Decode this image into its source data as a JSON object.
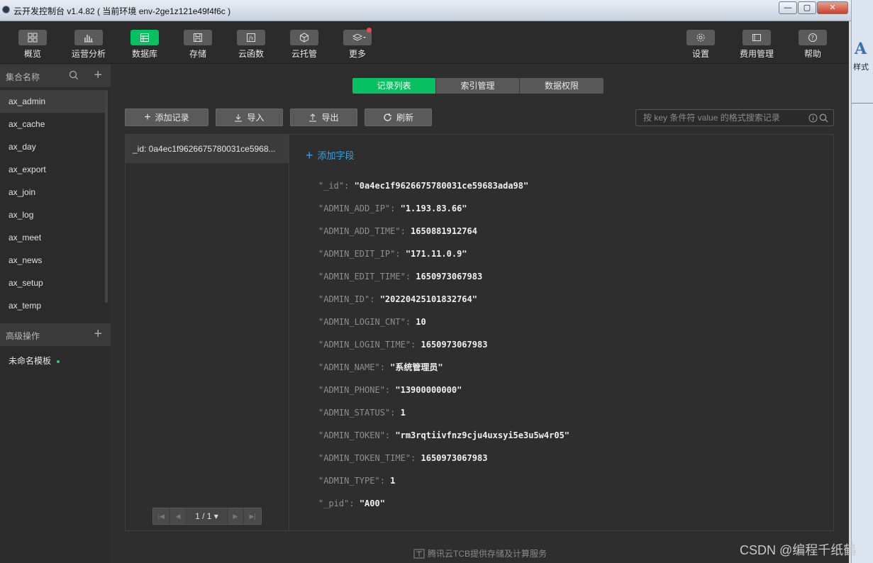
{
  "window": {
    "title": "云开发控制台 v1.4.82 ( 当前环境 env-2ge1z121e49f4f6c )",
    "buttons": [
      "—",
      "▢",
      "✕"
    ]
  },
  "toolbar": {
    "left": [
      {
        "label": "概览",
        "icon": "grid-icon"
      },
      {
        "label": "运营分析",
        "icon": "bar-chart-icon"
      },
      {
        "label": "数据库",
        "icon": "database-icon",
        "active": true
      },
      {
        "label": "存储",
        "icon": "save-icon"
      },
      {
        "label": "云函数",
        "icon": "function-icon"
      },
      {
        "label": "云托管",
        "icon": "cube-icon"
      },
      {
        "label": "更多",
        "icon": "layers-icon",
        "badge": true
      }
    ],
    "right": [
      {
        "label": "设置",
        "icon": "gear-icon"
      },
      {
        "label": "费用管理",
        "icon": "billing-icon"
      },
      {
        "label": "帮助",
        "icon": "help-icon"
      }
    ]
  },
  "sidebar": {
    "collections_title": "集合名称",
    "collections": [
      "ax_admin",
      "ax_cache",
      "ax_day",
      "ax_export",
      "ax_join",
      "ax_log",
      "ax_meet",
      "ax_news",
      "ax_setup",
      "ax_temp"
    ],
    "active_collection": "ax_admin",
    "advanced_title": "高级操作",
    "template_label": "未命名模板"
  },
  "tabs": [
    "记录列表",
    "索引管理",
    "数据权限"
  ],
  "actions": {
    "add_record": "添加记录",
    "import": "导入",
    "export": "导出",
    "refresh": "刷新"
  },
  "search": {
    "placeholder": "按 key 条件符 value 的格式搜索记录"
  },
  "records": [
    {
      "label": "_id: 0a4ec1f9626675780031ce5968..."
    }
  ],
  "pager": {
    "text": "1 / 1 ▾"
  },
  "detail": {
    "add_field": "添加字段",
    "fields": [
      {
        "key": "\"_id\"",
        "value": "\"0a4ec1f9626675780031ce59683ada98\""
      },
      {
        "key": "\"ADMIN_ADD_IP\"",
        "value": "\"1.193.83.66\""
      },
      {
        "key": "\"ADMIN_ADD_TIME\"",
        "value": "1650881912764"
      },
      {
        "key": "\"ADMIN_EDIT_IP\"",
        "value": "\"171.11.0.9\""
      },
      {
        "key": "\"ADMIN_EDIT_TIME\"",
        "value": "1650973067983"
      },
      {
        "key": "\"ADMIN_ID\"",
        "value": "\"20220425101832764\""
      },
      {
        "key": "\"ADMIN_LOGIN_CNT\"",
        "value": "10"
      },
      {
        "key": "\"ADMIN_LOGIN_TIME\"",
        "value": "1650973067983"
      },
      {
        "key": "\"ADMIN_NAME\"",
        "value": "\"系统管理员\""
      },
      {
        "key": "\"ADMIN_PHONE\"",
        "value": "\"13900000000\""
      },
      {
        "key": "\"ADMIN_STATUS\"",
        "value": "1"
      },
      {
        "key": "\"ADMIN_TOKEN\"",
        "value": "\"rm3rqtiivfnz9cju4uxsyi5e3u5w4r05\""
      },
      {
        "key": "\"ADMIN_TOKEN_TIME\"",
        "value": "1650973067983"
      },
      {
        "key": "\"ADMIN_TYPE\"",
        "value": "1"
      },
      {
        "key": "\"_pid\"",
        "value": "\"A00\""
      }
    ]
  },
  "footer": {
    "text": "腾讯云TCB提供存储及计算服务"
  },
  "watermark": "CSDN @编程千纸鹤",
  "background_window": {
    "glyph": "A",
    "text": "样式"
  },
  "colors": {
    "accent": "#07c160",
    "link": "#36a3e5",
    "badge": "#f04848"
  }
}
